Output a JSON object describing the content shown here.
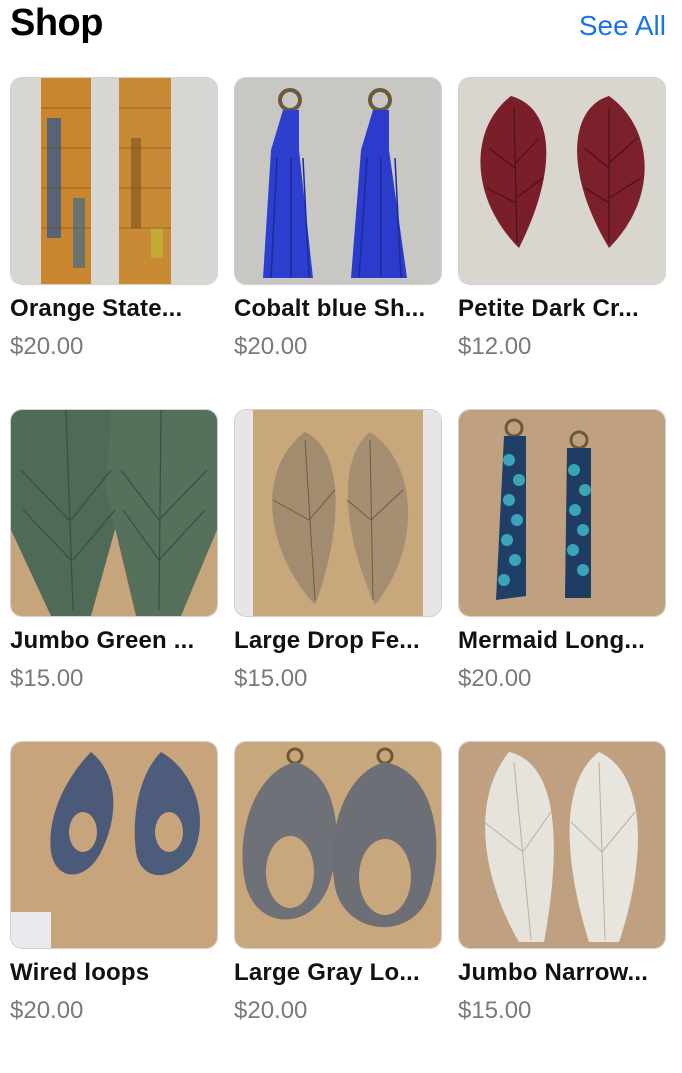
{
  "header": {
    "title": "Shop",
    "see_all_label": "See All",
    "accent_color": "#1a73e8"
  },
  "products": [
    {
      "name": "Orange State...",
      "price": "$20.00"
    },
    {
      "name": "Cobalt blue Sh...",
      "price": "$20.00"
    },
    {
      "name": "Petite Dark Cr...",
      "price": "$12.00"
    },
    {
      "name": "Jumbo Green ...",
      "price": "$15.00"
    },
    {
      "name": "Large Drop Fe...",
      "price": "$15.00"
    },
    {
      "name": "Mermaid Long...",
      "price": "$20.00"
    },
    {
      "name": "Wired loops",
      "price": "$20.00"
    },
    {
      "name": "Large Gray Lo...",
      "price": "$20.00"
    },
    {
      "name": "Jumbo Narrow...",
      "price": "$15.00"
    }
  ]
}
